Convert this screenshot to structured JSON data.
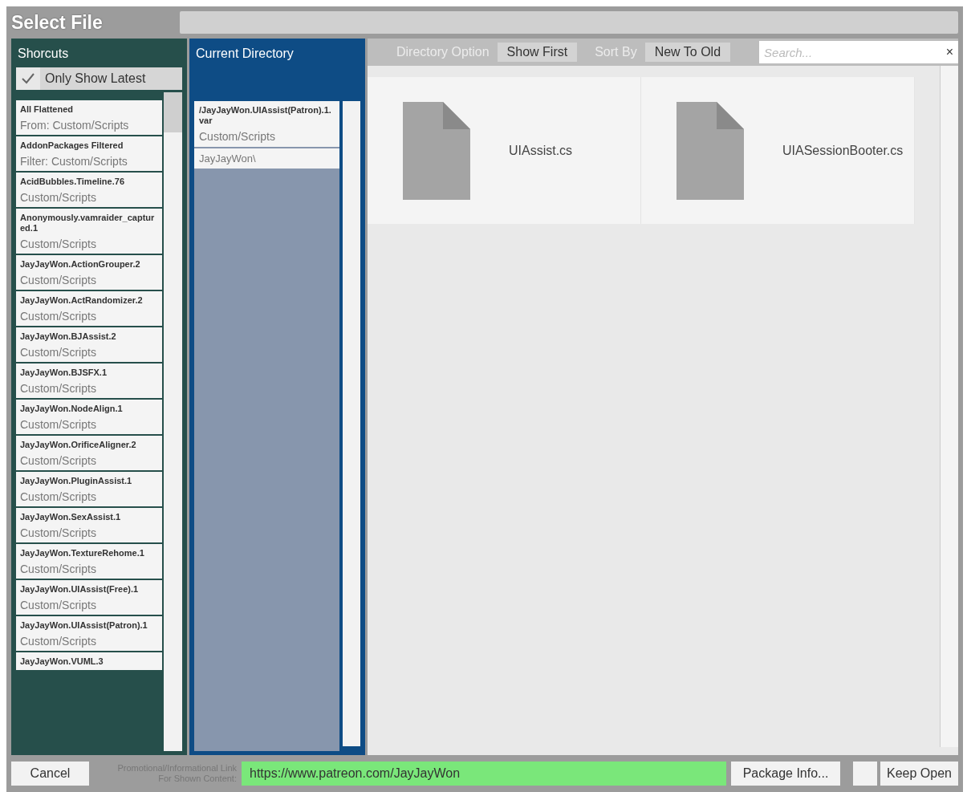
{
  "window": {
    "title": "Select File"
  },
  "shortcuts": {
    "title": "Shorcuts",
    "only_show_latest": {
      "label": "Only Show Latest",
      "checked": true
    },
    "items": [
      {
        "name": "All Flattened",
        "path": "From: Custom/Scripts"
      },
      {
        "name": "AddonPackages Filtered",
        "path": "Filter: Custom/Scripts"
      },
      {
        "name": "AcidBubbles.Timeline.76",
        "path": "Custom/Scripts"
      },
      {
        "name": "Anonymously.vamraider_captured.1",
        "path": "Custom/Scripts"
      },
      {
        "name": "JayJayWon.ActionGrouper.2",
        "path": "Custom/Scripts"
      },
      {
        "name": "JayJayWon.ActRandomizer.2",
        "path": "Custom/Scripts"
      },
      {
        "name": "JayJayWon.BJAssist.2",
        "path": "Custom/Scripts"
      },
      {
        "name": "JayJayWon.BJSFX.1",
        "path": "Custom/Scripts"
      },
      {
        "name": "JayJayWon.NodeAlign.1",
        "path": "Custom/Scripts"
      },
      {
        "name": "JayJayWon.OrificeAligner.2",
        "path": "Custom/Scripts"
      },
      {
        "name": "JayJayWon.PluginAssist.1",
        "path": "Custom/Scripts"
      },
      {
        "name": "JayJayWon.SexAssist.1",
        "path": "Custom/Scripts"
      },
      {
        "name": "JayJayWon.TextureRehome.1",
        "path": "Custom/Scripts"
      },
      {
        "name": "JayJayWon.UIAssist(Free).1",
        "path": "Custom/Scripts"
      },
      {
        "name": "JayJayWon.UIAssist(Patron).1",
        "path": "Custom/Scripts"
      },
      {
        "name": "JayJayWon.VUML.3"
      }
    ]
  },
  "current_directory": {
    "title": "Current Directory",
    "items": [
      {
        "kind": "package",
        "name": "/JayJayWon.UIAssist(Patron).1.var",
        "path": "Custom/Scripts"
      },
      {
        "kind": "folder",
        "name": "JayJayWon\\"
      }
    ]
  },
  "toolbar": {
    "directory_option": {
      "label": "Directory Option",
      "value": "Show First"
    },
    "sort_by": {
      "label": "Sort By",
      "value": "New To Old"
    },
    "search": {
      "placeholder": "Search...",
      "clear": "×"
    }
  },
  "files": [
    {
      "name": "UIAssist.cs"
    },
    {
      "name": "UIASessionBooter.cs"
    }
  ],
  "bottom_bar": {
    "cancel": "Cancel",
    "link_label": "Promotional/Informational Link For Shown Content:",
    "link": "https://www.patreon.com/JayJayWon",
    "package_info": "Package Info...",
    "keep_open": {
      "label": "Keep Open",
      "checked": false
    }
  }
}
